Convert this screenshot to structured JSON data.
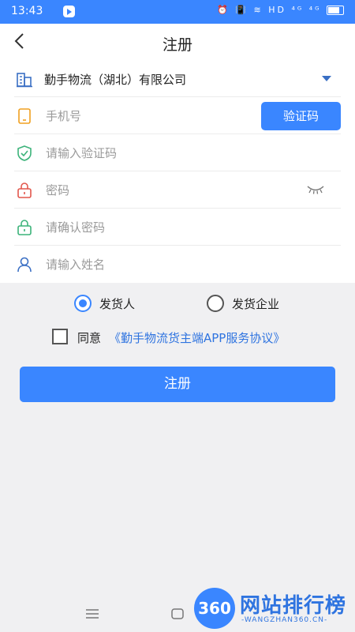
{
  "status_bar": {
    "time": "13:43",
    "icons_text": "⏰ 📳 ≋ HD ⁴ᴳ ⁴ᴳ"
  },
  "header": {
    "title": "注册"
  },
  "form": {
    "company": "勤手物流（湖北）有限公司",
    "phone_placeholder": "手机号",
    "code_button": "验证码",
    "code_placeholder": "请输入验证码",
    "password_placeholder": "密码",
    "confirm_placeholder": "请确认密码",
    "name_placeholder": "请输入姓名"
  },
  "roles": {
    "options": [
      "发货人",
      "发货企业"
    ],
    "selected": "发货人"
  },
  "agreement": {
    "prefix": "同意",
    "link": "《勤手物流货主端APP服务协议》",
    "checked": false
  },
  "submit_label": "注册",
  "watermark": {
    "badge": "360",
    "text": "网站排行榜",
    "sub": "-WANGZHAN360.CN-"
  },
  "colors": {
    "accent": "#3a86ff",
    "link": "#2f74e0",
    "background": "#f0f0f2"
  }
}
